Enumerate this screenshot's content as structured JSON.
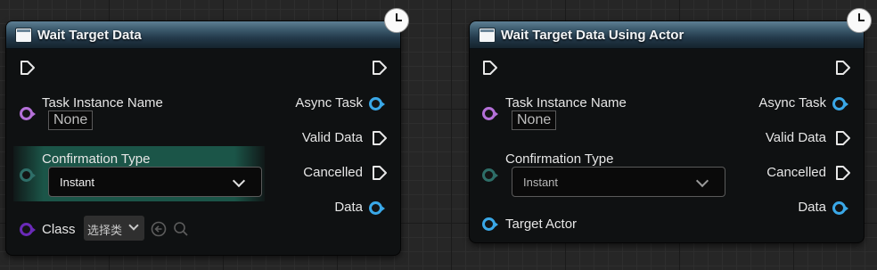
{
  "nodes": [
    {
      "title": "Wait Target Data",
      "inputs": {
        "task_instance_name_label": "Task Instance Name",
        "task_instance_name_value": "None",
        "confirmation_type_label": "Confirmation Type",
        "confirmation_type_value": "Instant",
        "class_label": "Class",
        "class_select_value": "选择类"
      },
      "outputs": {
        "async_task": "Async Task",
        "valid_data": "Valid Data",
        "cancelled": "Cancelled",
        "data": "Data"
      }
    },
    {
      "title": "Wait Target Data Using Actor",
      "inputs": {
        "task_instance_name_label": "Task Instance Name",
        "task_instance_name_value": "None",
        "confirmation_type_label": "Confirmation Type",
        "confirmation_type_value": "Instant",
        "target_actor_label": "Target Actor"
      },
      "outputs": {
        "async_task": "Async Task",
        "valid_data": "Valid Data",
        "cancelled": "Cancelled",
        "data": "Data"
      }
    }
  ],
  "icons": {
    "header": "function-icon",
    "latent": "clock-icon",
    "exec_pin": "exec-pin-icon",
    "use_selected": "use-selected-arrow-icon",
    "browse": "magnifier-icon"
  },
  "colors": {
    "string_pin": "#b470d8",
    "object_pin": "#3aa8e8",
    "enum_pin": "#2e6e68",
    "class_pin": "#6a2ab8",
    "header": "#3e5d70",
    "highlight": "#1b5548"
  }
}
